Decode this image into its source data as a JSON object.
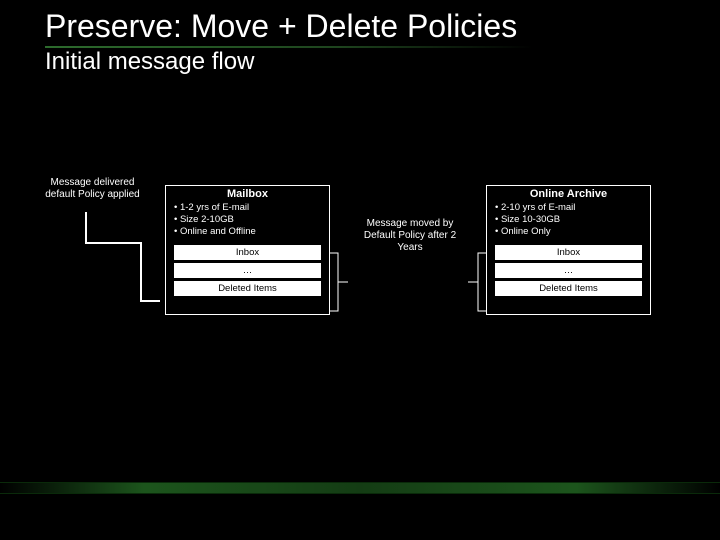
{
  "title": "Preserve: Move + Delete Policies",
  "subtitle": "Initial message flow",
  "labels": {
    "delivered": "Message delivered default Policy applied",
    "moved": "Message moved by Default Policy after 2 Years"
  },
  "mailbox": {
    "title": "Mailbox",
    "bullets": [
      "• 1-2 yrs of E-mail",
      "• Size 2-10GB",
      "• Online and Offline"
    ],
    "rows": {
      "inbox": "Inbox",
      "blank": "…",
      "deleted": "Deleted Items"
    }
  },
  "archive": {
    "title": "Online Archive",
    "bullets": [
      "• 2-10 yrs of E-mail",
      "• Size 10-30GB",
      "• Online Only"
    ],
    "rows": {
      "inbox": "Inbox",
      "blank": "…",
      "deleted": "Deleted Items"
    }
  }
}
